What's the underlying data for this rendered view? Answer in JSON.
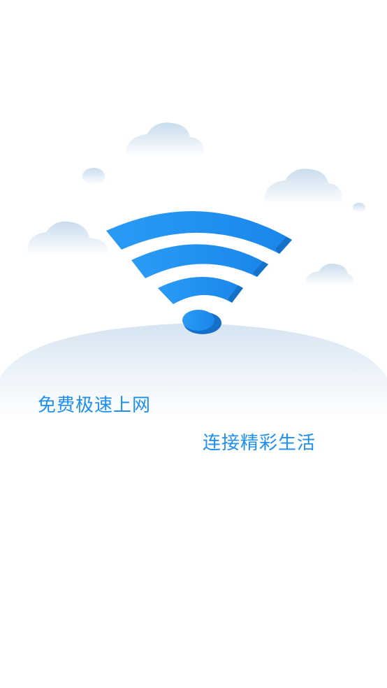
{
  "splash": {
    "slogan_primary": "免费极速上网",
    "slogan_secondary": "连接精彩生活"
  },
  "icons": {
    "hero": "wifi-signal-icon",
    "decor": [
      "cloud-icon",
      "cloud-icon",
      "cloud-icon",
      "cloud-icon",
      "cloud-icon",
      "cloud-icon"
    ]
  },
  "colors": {
    "accent": "#1e8ff0",
    "accent_dark": "#1478d6",
    "cloud": "#d6e6f3",
    "background": "#ffffff"
  }
}
